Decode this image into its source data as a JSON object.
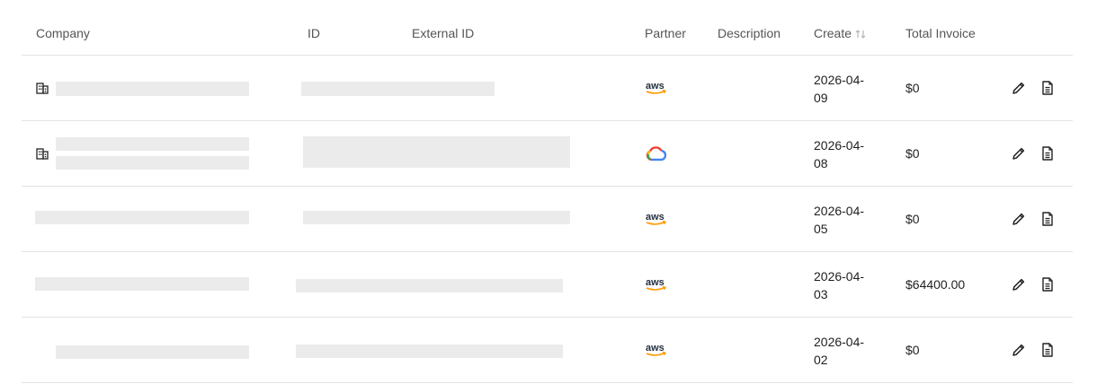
{
  "columns": {
    "company": "Company",
    "id": "ID",
    "external_id": "External ID",
    "partner": "Partner",
    "description": "Description",
    "create": "Create",
    "total_invoice": "Total Invoice"
  },
  "rows": [
    {
      "partner": "aws",
      "partner_logo_text": "aws",
      "create_line1": "2026-04-",
      "create_line2": "09",
      "total": "$0"
    },
    {
      "partner": "google-cloud",
      "partner_logo_text": "",
      "create_line1": "2026-04-",
      "create_line2": "08",
      "total": "$0"
    },
    {
      "partner": "aws",
      "partner_logo_text": "aws",
      "create_line1": "2026-04-",
      "create_line2": "05",
      "total": "$0"
    },
    {
      "partner": "aws",
      "partner_logo_text": "aws",
      "create_line1": "2026-04-",
      "create_line2": "03",
      "total": "$64400.00"
    },
    {
      "partner": "aws",
      "partner_logo_text": "aws",
      "create_line1": "2026-04-",
      "create_line2": "02",
      "total": "$0"
    }
  ],
  "icons": {
    "company": "building-icon",
    "sort": "sort-icon",
    "edit": "pencil-icon",
    "document": "document-icon"
  },
  "colors": {
    "aws_text": "#232f3e",
    "aws_smile": "#ff9900",
    "redaction": "#ebebeb",
    "border": "#e3e3e3"
  }
}
